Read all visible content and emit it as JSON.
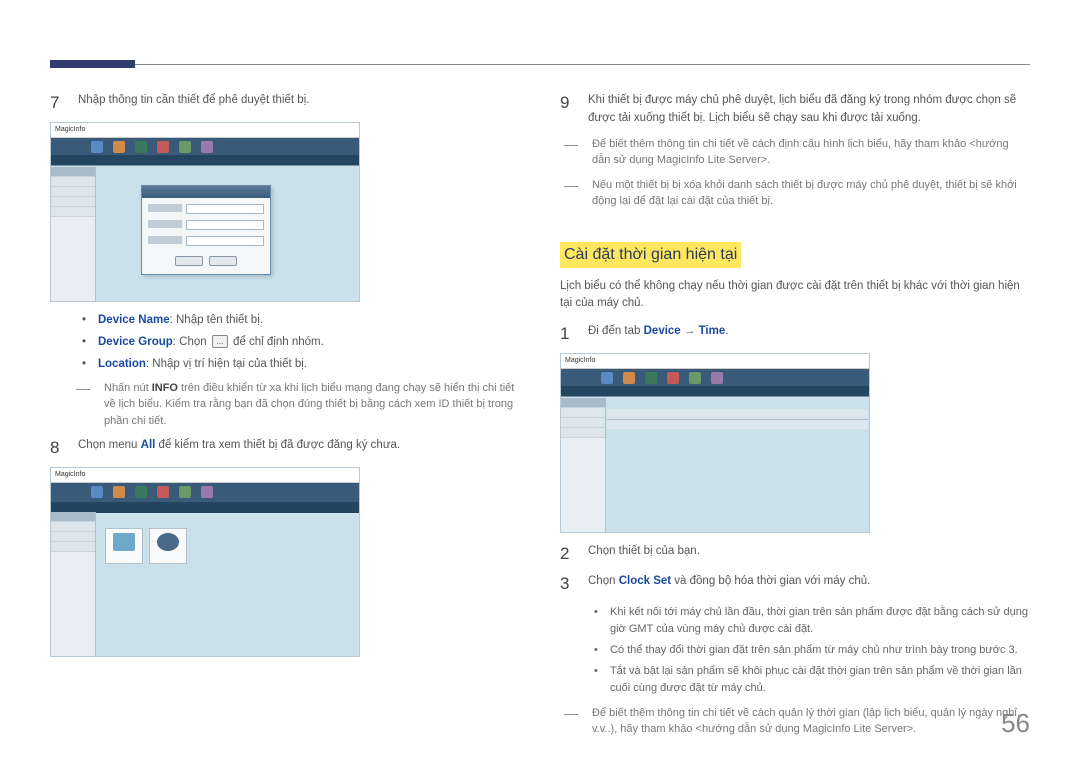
{
  "page_number": "56",
  "left": {
    "step7": {
      "num": "7",
      "text": "Nhập thông tin cần thiết để phê duyệt thiết bị."
    },
    "fields": {
      "device_name_label": "Device Name",
      "device_name_text": ": Nhập tên thiết bị.",
      "device_group_label": "Device Group",
      "device_group_pre": ": Chọn ",
      "device_group_post": " để chỉ định nhóm.",
      "browse_icon": "...",
      "location_label": "Location",
      "location_text": ": Nhập vị trí hiện tại của thiết bị."
    },
    "note": {
      "pre": "Nhấn nút ",
      "info": "INFO",
      "post": " trên điều khiển từ xa khi lịch biểu mạng đang chạy sẽ hiển thị chi tiết về lịch biểu. Kiểm tra rằng bạn đã chọn đúng thiết bị bằng cách xem ID thiết bị trong phần chi tiết."
    },
    "step8": {
      "num": "8",
      "pre": "Chọn menu ",
      "all": "All",
      "post": " để kiểm tra xem thiết bị đã được đăng ký chưa."
    },
    "screenshot_logo": "MagicInfo"
  },
  "right": {
    "step9": {
      "num": "9",
      "text": "Khi thiết bị được máy chủ phê duyệt, lịch biểu đã đăng ký trong nhóm được chọn sẽ được tải xuống thiết bị. Lịch biểu sẽ chạy sau khi được tải xuống."
    },
    "note1": "Để biết thêm thông tin chi tiết về cách định cấu hình lịch biểu, hãy tham khảo <hướng dẫn sử dụng MagicInfo Lite Server>.",
    "note2": "Nếu một thiết bị bị xóa khỏi danh sách thiết bị được máy chủ phê duyệt, thiết bị sẽ khởi động lại để đặt lại cài đặt của thiết bị.",
    "heading": "Cài đặt thời gian hiện tại",
    "lead": "Lịch biểu có thể không chạy nếu thời gian được cài đặt trên thiết bị khác với thời gian hiện tại của máy chủ.",
    "step1": {
      "num": "1",
      "pre": "Đi đến tab ",
      "device": "Device",
      "arrow": " → ",
      "time": "Time",
      "post": "."
    },
    "step2": {
      "num": "2",
      "text": "Chọn thiết bị của bạn."
    },
    "step3": {
      "num": "3",
      "pre": "Chọn ",
      "clock_set": "Clock Set",
      "post": " và đồng bộ hóa thời gian với máy chủ."
    },
    "sub1": "Khi kết nối tới máy chủ lần đầu, thời gian trên sản phẩm được đặt bằng cách sử dụng giờ GMT của vùng máy chủ được cài đặt.",
    "sub2": "Có thể thay đổi thời gian đặt trên sản phẩm từ máy chủ như trình bày trong bước 3.",
    "sub3": "Tắt và bật lại sản phẩm sẽ khôi phục cài đặt thời gian trên sản phẩm về thời gian lần cuối cùng được đặt từ máy chủ.",
    "note3": "Để biết thêm thông tin chi tiết về cách quản lý thời gian (lập lịch biểu, quản lý ngày nghỉ, v.v..), hãy tham khảo <hướng dẫn sử dụng MagicInfo Lite Server>."
  }
}
